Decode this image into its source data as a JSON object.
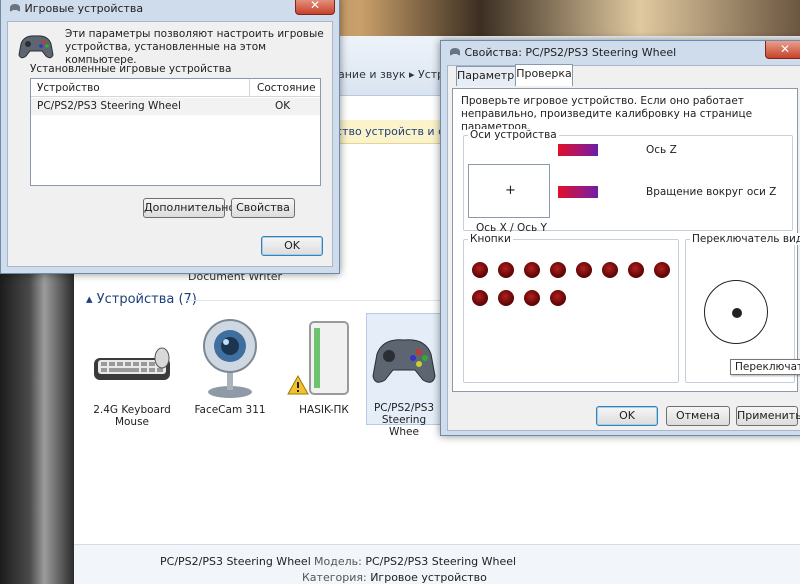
{
  "background_window": {
    "breadcrumb": "ание и звук  ▸  Устро",
    "toolbar_text": "ство устройств и сведения и",
    "doc_writer": "Document Writer",
    "devices_group": "Устройства (7)",
    "devices": [
      {
        "name": "2.4G Keyboard Mouse",
        "icon": "keyboard-icon"
      },
      {
        "name": "FaceCam 311",
        "icon": "webcam-icon"
      },
      {
        "name": "HASIK-ПК",
        "icon": "computer-tower-icon"
      },
      {
        "name": "PC/PS2/PS3 Steering Whee",
        "icon": "gamepad-icon"
      }
    ],
    "status": {
      "device_name": "PC/PS2/PS3 Steering Wheel",
      "model_label": "Модель:",
      "model_value": "PC/PS2/PS3 Steering Wheel",
      "category_label": "Категория:",
      "category_value": "Игровое устройство"
    }
  },
  "game_controllers": {
    "title": "Игровые устройства",
    "close": "✕",
    "description": "Эти параметры позволяют настроить игровые устройства, установленные на этом компьютере.",
    "installed_label": "Установленные игровые устройства",
    "columns": [
      "Устройство",
      "Состояние"
    ],
    "rows": [
      {
        "device": "PC/PS2/PS3 Steering Wheel",
        "status": "OK"
      }
    ],
    "advanced_button": "Дополнительно...",
    "properties_button": "Свойства",
    "ok_button": "OK"
  },
  "properties": {
    "title": "Свойства: PC/PS2/PS3 Steering Wheel",
    "close": "✕",
    "tabs": [
      "Параметры",
      "Проверка"
    ],
    "active_tab": 1,
    "description": "Проверьте игровое устройство. Если оно работает неправильно, произведите калибровку на странице параметров.",
    "axes_group": "Оси устройства",
    "axis_xy_label": "Ось X / Ось Y",
    "crosshair": "+",
    "axis_z_label": "Ось Z",
    "rotation_z_label": "Вращение вокруг оси Z",
    "buttons_group": "Кнопки",
    "button_count": 12,
    "pov_group": "Переключатель вида",
    "tooltip": "Переключате",
    "ok_button": "OK",
    "cancel_button": "Отмена",
    "apply_button": "Применить"
  },
  "colors": {
    "dialog_frame": "#cfdcec",
    "dialog_body": "#f0f0f0",
    "close_red": "#c7422a",
    "link_blue": "#1e3f7a",
    "button_dot": "#8b0d0d"
  }
}
